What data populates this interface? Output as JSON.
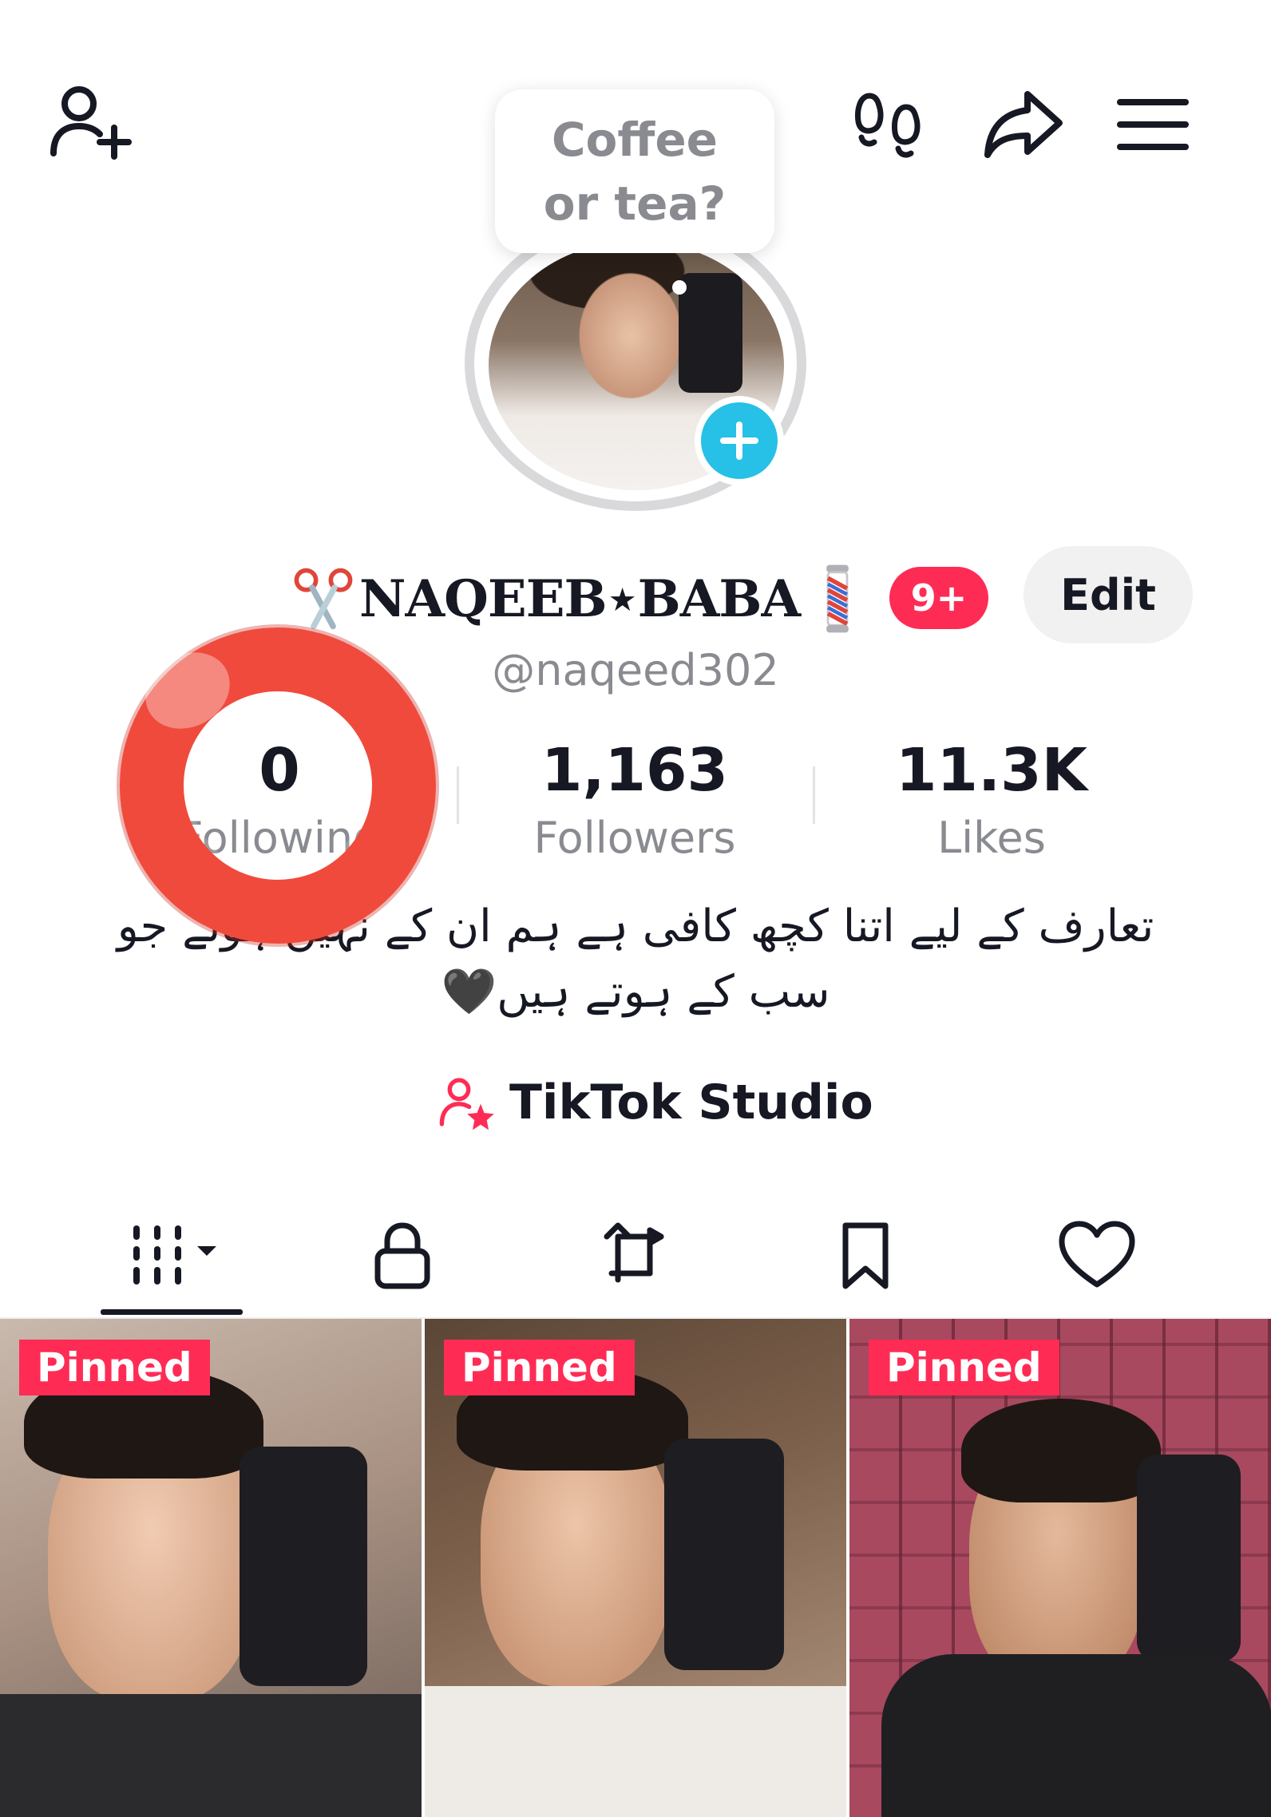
{
  "topbar": {
    "add_friend_icon": "person-add-icon",
    "footprints_icon": "footprints-icon",
    "share_icon": "share-arrow-icon",
    "menu_icon": "hamburger-menu-icon"
  },
  "bubble": {
    "text": "Coffee or tea?"
  },
  "profile": {
    "display_name": "NAQEEB⋆BABA",
    "name_prefix_icon": "scissors-icon",
    "name_suffix_icon": "barber-pole-icon",
    "notification_badge": "9+",
    "edit_label": "Edit",
    "username": "@naqeed302"
  },
  "stats": {
    "following": {
      "value": "0",
      "label": "Following"
    },
    "followers": {
      "value": "1,163",
      "label": "Followers"
    },
    "likes": {
      "value": "11.3K",
      "label": "Likes"
    }
  },
  "bio": {
    "line1": "تعارف کے لیے اتنا کچھ کافی ہے ہم ان کے نہیں ہوتے جو",
    "line2": "سب کے ہوتے ہیں🖤"
  },
  "studio": {
    "label": "TikTok Studio",
    "icon": "creator-star-icon"
  },
  "tabs": [
    {
      "name": "videos",
      "icon": "grid-videos-icon",
      "active": true
    },
    {
      "name": "private",
      "icon": "lock-icon"
    },
    {
      "name": "reposts",
      "icon": "repost-icon"
    },
    {
      "name": "favorites",
      "icon": "bookmark-icon"
    },
    {
      "name": "liked",
      "icon": "heart-icon"
    }
  ],
  "videos": [
    {
      "badge": "Pinned"
    },
    {
      "badge": "Pinned"
    },
    {
      "badge": "Pinned"
    }
  ],
  "colors": {
    "accent": "#fe2c55",
    "avatar_add": "#27c0e6",
    "highlight_ring": "#f04a3c",
    "secondary_text": "#8a8b91"
  }
}
